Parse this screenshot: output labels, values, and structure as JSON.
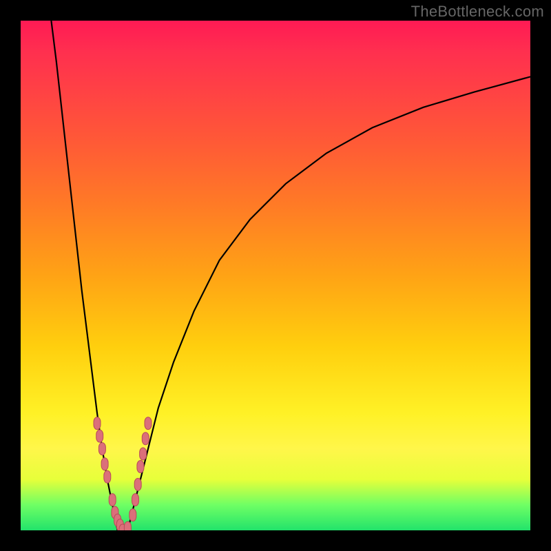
{
  "watermark": "TheBottleneck.com",
  "chart_data": {
    "type": "line",
    "title": "",
    "xlabel": "",
    "ylabel": "",
    "xlim": [
      0,
      100
    ],
    "ylim": [
      0,
      100
    ],
    "series": [
      {
        "name": "left-branch",
        "x": [
          6,
          7,
          8,
          9,
          10,
          11,
          12,
          13,
          14,
          15,
          16,
          17,
          18,
          19
        ],
        "y": [
          100,
          92,
          83,
          74,
          65,
          56,
          47,
          39,
          31,
          23,
          16,
          10,
          5,
          0
        ]
      },
      {
        "name": "right-branch",
        "x": [
          21,
          23,
          25,
          27,
          30,
          34,
          39,
          45,
          52,
          60,
          69,
          79,
          89,
          100
        ],
        "y": [
          0,
          8,
          16,
          24,
          33,
          43,
          53,
          61,
          68,
          74,
          79,
          83,
          86,
          89
        ]
      }
    ],
    "marker_points": {
      "name": "sample-markers",
      "x": [
        15,
        15.5,
        16,
        16.5,
        17,
        18,
        18.5,
        19,
        19.5,
        20,
        21,
        22,
        22.5,
        23,
        23.5,
        24,
        24.5,
        25
      ],
      "y": [
        21,
        18.5,
        16,
        13,
        10.5,
        6,
        3.5,
        2,
        1,
        0,
        0.5,
        3,
        6,
        9,
        12.5,
        15,
        18,
        21
      ]
    },
    "gradient_stops": [
      {
        "pos": 0,
        "color": "#ff1a54"
      },
      {
        "pos": 14,
        "color": "#ff4244"
      },
      {
        "pos": 36,
        "color": "#ff7a26"
      },
      {
        "pos": 64,
        "color": "#ffcf0e"
      },
      {
        "pos": 84,
        "color": "#fff64a"
      },
      {
        "pos": 95,
        "color": "#6fff64"
      },
      {
        "pos": 100,
        "color": "#22e36b"
      }
    ]
  }
}
